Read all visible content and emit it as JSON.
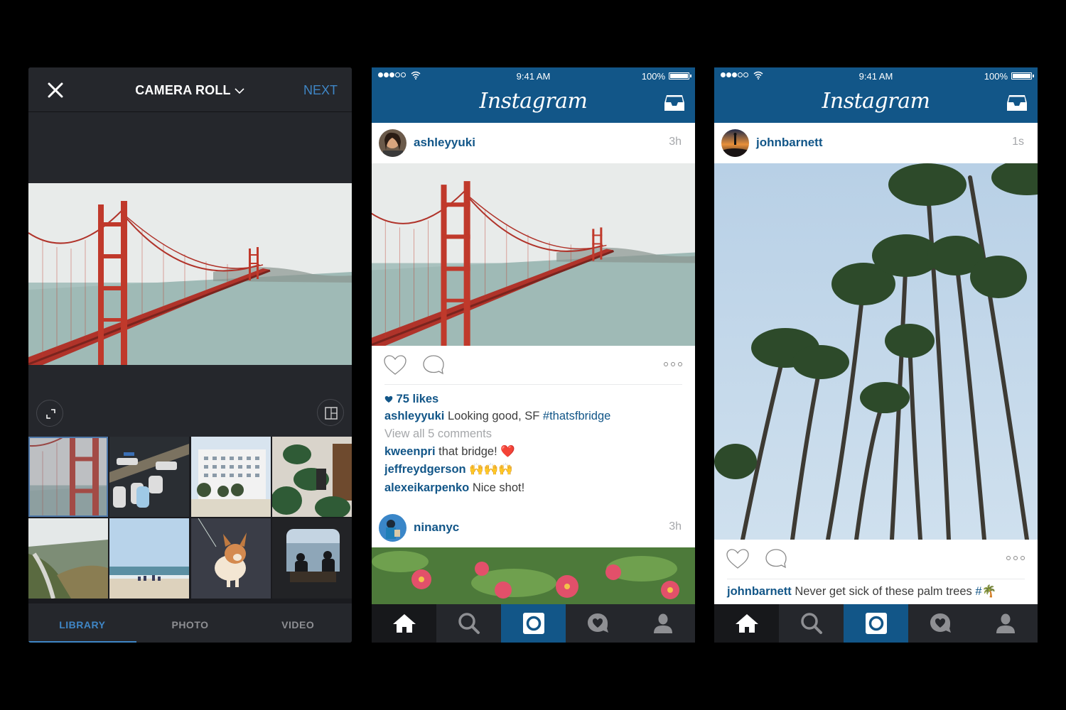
{
  "camera_roll": {
    "title": "CAMERA ROLL",
    "next_label": "NEXT",
    "close_icon": "close-icon",
    "expand_icon": "expand-icon",
    "layout_icon": "layout-icon",
    "preview_subject": "Golden Gate Bridge",
    "thumbnails": [
      {
        "subject": "Golden Gate Bridge in fog",
        "selected": true
      },
      {
        "subject": "Boats at dock"
      },
      {
        "subject": "White building with trees"
      },
      {
        "subject": "Person with plants"
      },
      {
        "subject": "Coastal hills road"
      },
      {
        "subject": "Beach with people"
      },
      {
        "subject": "Corgi on carpet"
      },
      {
        "subject": "Silhouettes by window"
      }
    ],
    "tabs": [
      {
        "label": "LIBRARY",
        "active": true
      },
      {
        "label": "PHOTO"
      },
      {
        "label": "VIDEO"
      }
    ]
  },
  "status_bar": {
    "time": "9:41 AM",
    "battery": "100%",
    "signal_bars": 3,
    "signal_total": 5
  },
  "app": {
    "logo": "Instagram",
    "inbox_icon": "inbox-icon"
  },
  "feed1": {
    "post": {
      "username": "ashleyyuki",
      "time_ago": "3h",
      "image": "Golden Gate Bridge",
      "likes": "75 likes",
      "caption_user": "ashleyyuki",
      "caption_text": " Looking good, SF ",
      "caption_tag": "#thatsfbridge",
      "view_comments": "View all 5 comments",
      "comments": [
        {
          "user": "kweenpri",
          "text": " that bridge! ❤️"
        },
        {
          "user": "jeffreydgerson",
          "text": " 🙌🙌🙌"
        },
        {
          "user": "alexeikarpenko",
          "text": " Nice shot!"
        }
      ]
    },
    "next_post": {
      "username": "ninanyc",
      "time_ago": "3h",
      "image": "Red flowers and greenery"
    }
  },
  "feed2": {
    "post": {
      "username": "johnbarnett",
      "time_ago": "1s",
      "image": "Palm trees against blue sky",
      "caption_user": "johnbarnett",
      "caption_text": " Never get sick of these palm trees ",
      "caption_tag": "#🌴"
    }
  },
  "tabbar": [
    "home",
    "search",
    "camera",
    "activity",
    "profile"
  ],
  "colors": {
    "brand_blue": "#125688",
    "accent_blue": "#3f86c6",
    "dark_bg": "#25272c",
    "muted_text": "#a5a7aa"
  }
}
